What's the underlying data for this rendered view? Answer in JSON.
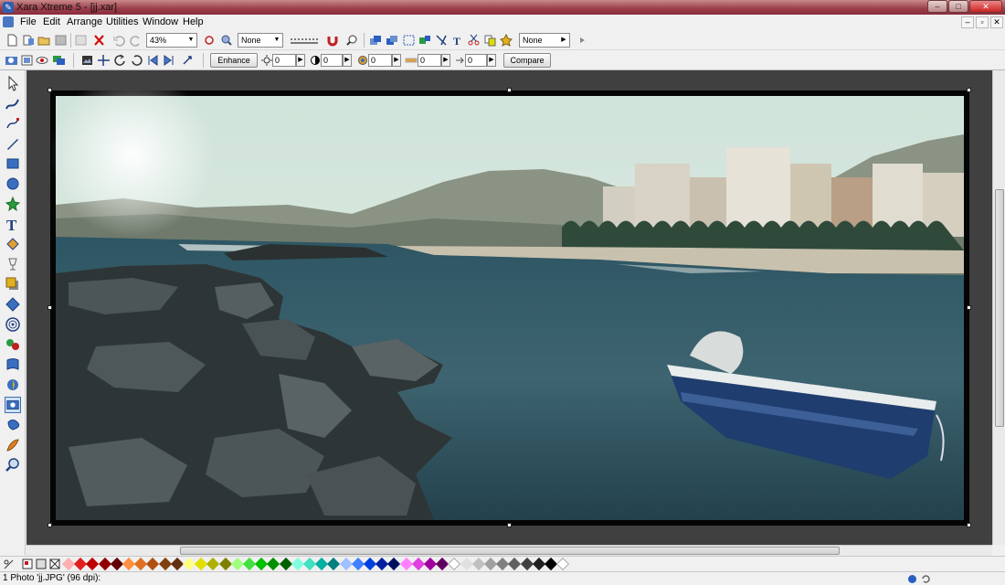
{
  "window": {
    "title": "Xara Xtreme 5 - [jj.xar]",
    "controls": [
      "–",
      "□",
      "✕"
    ],
    "mdi_controls": [
      "–",
      "▫",
      "✕"
    ]
  },
  "menu": {
    "items": [
      {
        "label": "File"
      },
      {
        "label": "Edit"
      },
      {
        "label": "Arrange"
      },
      {
        "label": "Utilities"
      },
      {
        "label": "Window"
      },
      {
        "label": "Help"
      }
    ]
  },
  "toolbar1": {
    "zoom_value": "43%",
    "quality_value": "None",
    "shadow_value": "None"
  },
  "toolbar2": {
    "enhance_label": "Enhance",
    "brightness": "0",
    "contrast": "0",
    "saturation": "0",
    "temperature": "0",
    "fill": "0",
    "compare_label": "Compare"
  },
  "status": {
    "text": "1 Photo 'jj.JPG' (96 dpi):"
  },
  "colors": {
    "canvas_bg": "#404040",
    "palette": [
      "#ffb0b0",
      "#e02020",
      "#c00000",
      "#900000",
      "#600000",
      "#ff9040",
      "#e07020",
      "#b05010",
      "#804010",
      "#603010",
      "#ffff80",
      "#e0e000",
      "#b0b000",
      "#808000",
      "#a0ff80",
      "#40e040",
      "#00c000",
      "#009000",
      "#006000",
      "#80ffe0",
      "#40e0c0",
      "#00b0a0",
      "#008080",
      "#a0c0ff",
      "#4080ff",
      "#0040e0",
      "#0020a0",
      "#001060",
      "#ff80ff",
      "#e040e0",
      "#a000a0",
      "#600060",
      "#ffffff",
      "#e0e0e0",
      "#c0c0c0",
      "#a0a0a0",
      "#808080",
      "#606060",
      "#404040",
      "#202020",
      "#000000",
      "#ffffff"
    ]
  }
}
